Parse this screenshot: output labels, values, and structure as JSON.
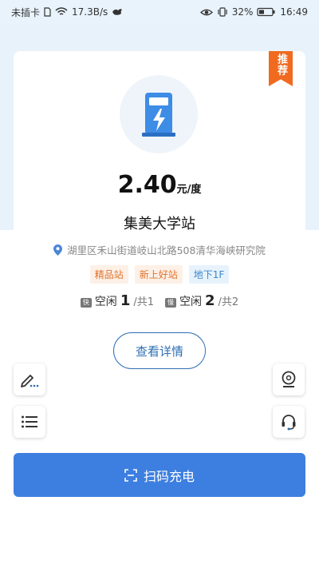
{
  "status_bar": {
    "carrier": "未插卡",
    "speed": "17.3B/s",
    "battery": "32%",
    "time": "16:49"
  },
  "station": {
    "badge": "推荐",
    "price": "2.40",
    "price_unit": "元/度",
    "name": "集美大学站",
    "address": "湖里区禾山街道岐山北路508清华海峡研究院",
    "tags": [
      "精品站",
      "新上好站",
      "地下1F"
    ],
    "fast": {
      "badge": "快",
      "label": "空闲",
      "free": "1",
      "total": "/共1"
    },
    "slow": {
      "badge": "慢",
      "label": "空闲",
      "free": "2",
      "total": "/共2"
    },
    "detail_label": "查看详情"
  },
  "actions": {
    "scan_label": "扫码充电"
  },
  "colors": {
    "accent": "#3d7fe0",
    "ribbon": "#f06a20",
    "tag_orange": "#e0742e",
    "tag_blue": "#3a86c8"
  }
}
